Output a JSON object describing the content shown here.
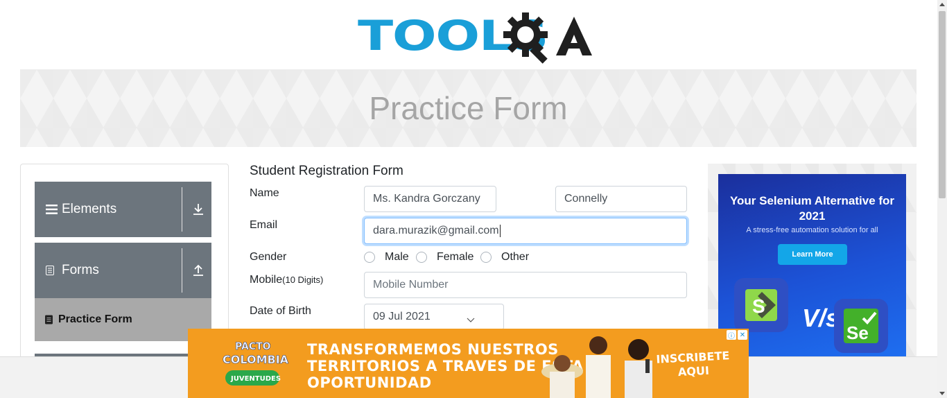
{
  "header": {
    "logo_tools": "TOOLS",
    "logo_qa": "QA"
  },
  "banner": {
    "title": "Practice Form"
  },
  "sidebar": {
    "groups": [
      {
        "label": "Elements",
        "icon": "hamburger-icon",
        "arrow": "download-arrow-icon"
      },
      {
        "label": "Forms",
        "icon": "document-icon",
        "arrow": "upload-arrow-icon"
      }
    ],
    "active_item": {
      "label": "Practice Form",
      "icon": "form-icon"
    }
  },
  "form": {
    "title": "Student Registration Form",
    "name_label": "Name",
    "first_name": "Ms. Kandra Gorczany",
    "last_name": "Connelly",
    "email_label": "Email",
    "email": "dara.murazik@gmail.com",
    "gender_label": "Gender",
    "gender_options": [
      "Male",
      "Female",
      "Other"
    ],
    "mobile_label": "Mobile",
    "mobile_hint": "(10 Digits)",
    "mobile_placeholder": "Mobile Number",
    "dob_label": "Date of Birth",
    "dob": "09 Jul 2021"
  },
  "side_ad": {
    "title": "Your Selenium Alternative for 2021",
    "subtitle": "A stress-free automation solution for all",
    "button": "Learn More",
    "vs": "V/s",
    "se": "Se"
  },
  "bottom_ad": {
    "logo_line1": "PACTO",
    "logo_line2": "COLOMBIA",
    "logo_line3": "JUVENTUDES",
    "text": "TRANSFORMEMOS NUESTROS TERRITORIOS A TRAVES DE ESTA OPORTUNIDAD",
    "text_l1": "TRANSFORMEMOS NUESTROS",
    "text_l2": "TERRITORIOS A TRAVES DE ESTA",
    "text_l3": "OPORTUNIDAD",
    "cta_l1": "INSCRIBETE",
    "cta_l2": "AQUI",
    "colors": {
      "background": "#f39c1f"
    }
  },
  "colors": {
    "brand_blue": "#1a9fd8",
    "sidebar_group": "#6c757d",
    "sidebar_active": "#a9a9a9",
    "focus": "#80bdff"
  }
}
